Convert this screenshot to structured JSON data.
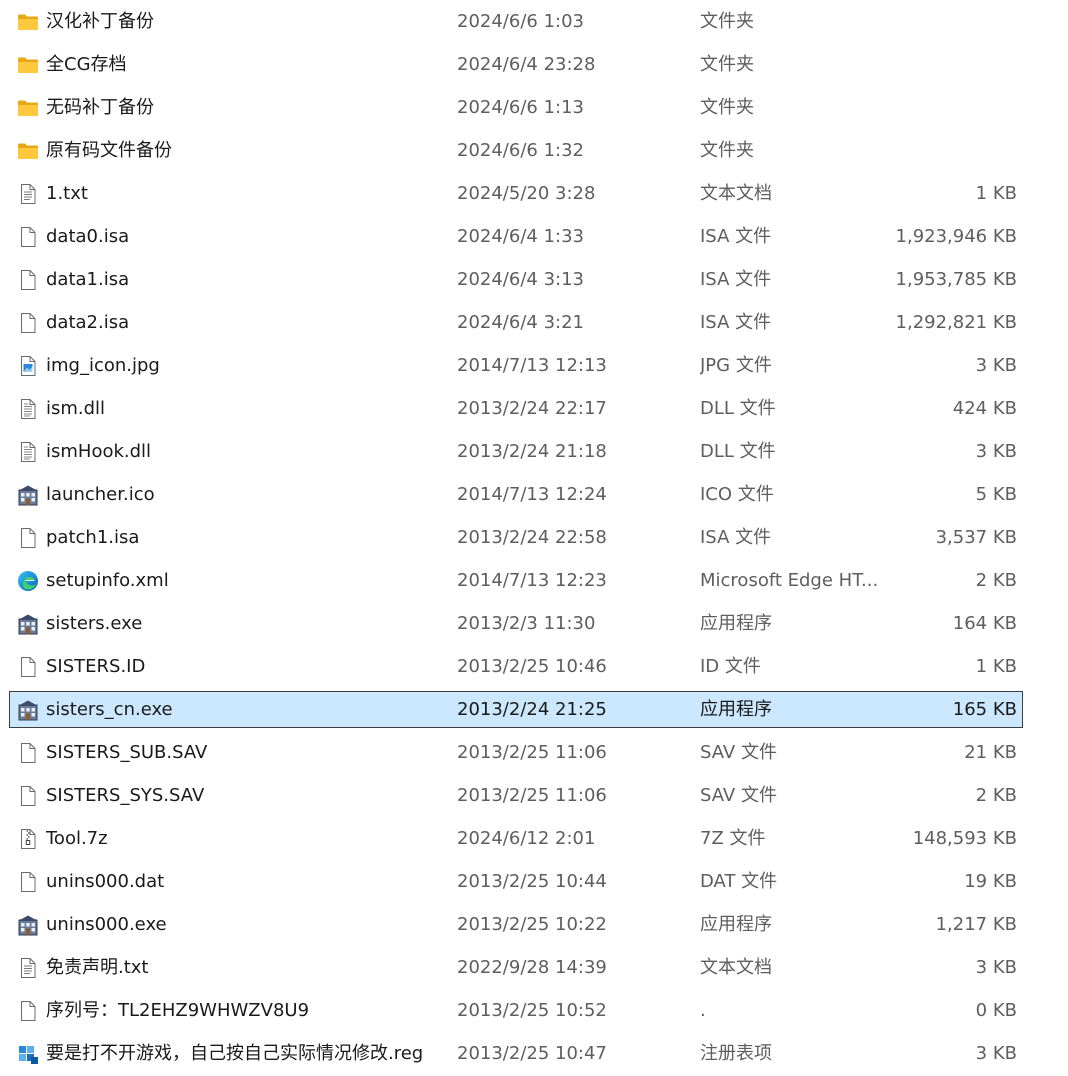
{
  "files": [
    {
      "name": "汉化补丁备份",
      "date": "2024/6/6 1:03",
      "type": "文件夹",
      "size": "",
      "icon": "folder-icon"
    },
    {
      "name": "全CG存档",
      "date": "2024/6/4 23:28",
      "type": "文件夹",
      "size": "",
      "icon": "folder-icon"
    },
    {
      "name": "无码补丁备份",
      "date": "2024/6/6 1:13",
      "type": "文件夹",
      "size": "",
      "icon": "folder-icon"
    },
    {
      "name": "原有码文件备份",
      "date": "2024/6/6 1:32",
      "type": "文件夹",
      "size": "",
      "icon": "folder-icon"
    },
    {
      "name": "1.txt",
      "date": "2024/5/20 3:28",
      "type": "文本文档",
      "size": "1 KB",
      "icon": "text-document-icon"
    },
    {
      "name": "data0.isa",
      "date": "2024/6/4 1:33",
      "type": "ISA 文件",
      "size": "1,923,946 KB",
      "icon": "file-icon"
    },
    {
      "name": "data1.isa",
      "date": "2024/6/4 3:13",
      "type": "ISA 文件",
      "size": "1,953,785 KB",
      "icon": "file-icon"
    },
    {
      "name": "data2.isa",
      "date": "2024/6/4 3:21",
      "type": "ISA 文件",
      "size": "1,292,821 KB",
      "icon": "file-icon"
    },
    {
      "name": "img_icon.jpg",
      "date": "2014/7/13 12:13",
      "type": "JPG 文件",
      "size": "3 KB",
      "icon": "image-file-icon"
    },
    {
      "name": "ism.dll",
      "date": "2013/2/24 22:17",
      "type": "DLL 文件",
      "size": "424 KB",
      "icon": "dll-file-icon"
    },
    {
      "name": "ismHook.dll",
      "date": "2013/2/24 21:18",
      "type": "DLL 文件",
      "size": "3 KB",
      "icon": "dll-file-icon"
    },
    {
      "name": "launcher.ico",
      "date": "2014/7/13 12:24",
      "type": "ICO 文件",
      "size": "5 KB",
      "icon": "app-icon"
    },
    {
      "name": "patch1.isa",
      "date": "2013/2/24 22:58",
      "type": "ISA 文件",
      "size": "3,537 KB",
      "icon": "file-icon"
    },
    {
      "name": "setupinfo.xml",
      "date": "2014/7/13 12:23",
      "type": "Microsoft Edge HT...",
      "size": "2 KB",
      "icon": "edge-icon"
    },
    {
      "name": "sisters.exe",
      "date": "2013/2/3 11:30",
      "type": "应用程序",
      "size": "164 KB",
      "icon": "app-icon"
    },
    {
      "name": "SISTERS.ID",
      "date": "2013/2/25 10:46",
      "type": "ID 文件",
      "size": "1 KB",
      "icon": "file-icon"
    },
    {
      "name": "sisters_cn.exe",
      "date": "2013/2/24 21:25",
      "type": "应用程序",
      "size": "165 KB",
      "icon": "app-icon",
      "selected": true
    },
    {
      "name": "SISTERS_SUB.SAV",
      "date": "2013/2/25 11:06",
      "type": "SAV 文件",
      "size": "21 KB",
      "icon": "file-icon"
    },
    {
      "name": "SISTERS_SYS.SAV",
      "date": "2013/2/25 11:06",
      "type": "SAV 文件",
      "size": "2 KB",
      "icon": "file-icon"
    },
    {
      "name": "Tool.7z",
      "date": "2024/6/12 2:01",
      "type": "7Z 文件",
      "size": "148,593 KB",
      "icon": "archive-file-icon"
    },
    {
      "name": "unins000.dat",
      "date": "2013/2/25 10:44",
      "type": "DAT 文件",
      "size": "19 KB",
      "icon": "file-icon"
    },
    {
      "name": "unins000.exe",
      "date": "2013/2/25 10:22",
      "type": "应用程序",
      "size": "1,217 KB",
      "icon": "app-icon"
    },
    {
      "name": "免责声明.txt",
      "date": "2022/9/28 14:39",
      "type": "文本文档",
      "size": "3 KB",
      "icon": "text-document-icon"
    },
    {
      "name": "序列号：TL2EHZ9WHWZV8U9",
      "date": "2013/2/25 10:52",
      "type": ".",
      "size": "0 KB",
      "icon": "file-icon"
    },
    {
      "name": "要是打不开游戏，自己按自己实际情况修改.reg",
      "date": "2013/2/25 10:47",
      "type": "注册表项",
      "size": "3 KB",
      "icon": "registry-file-icon"
    }
  ]
}
